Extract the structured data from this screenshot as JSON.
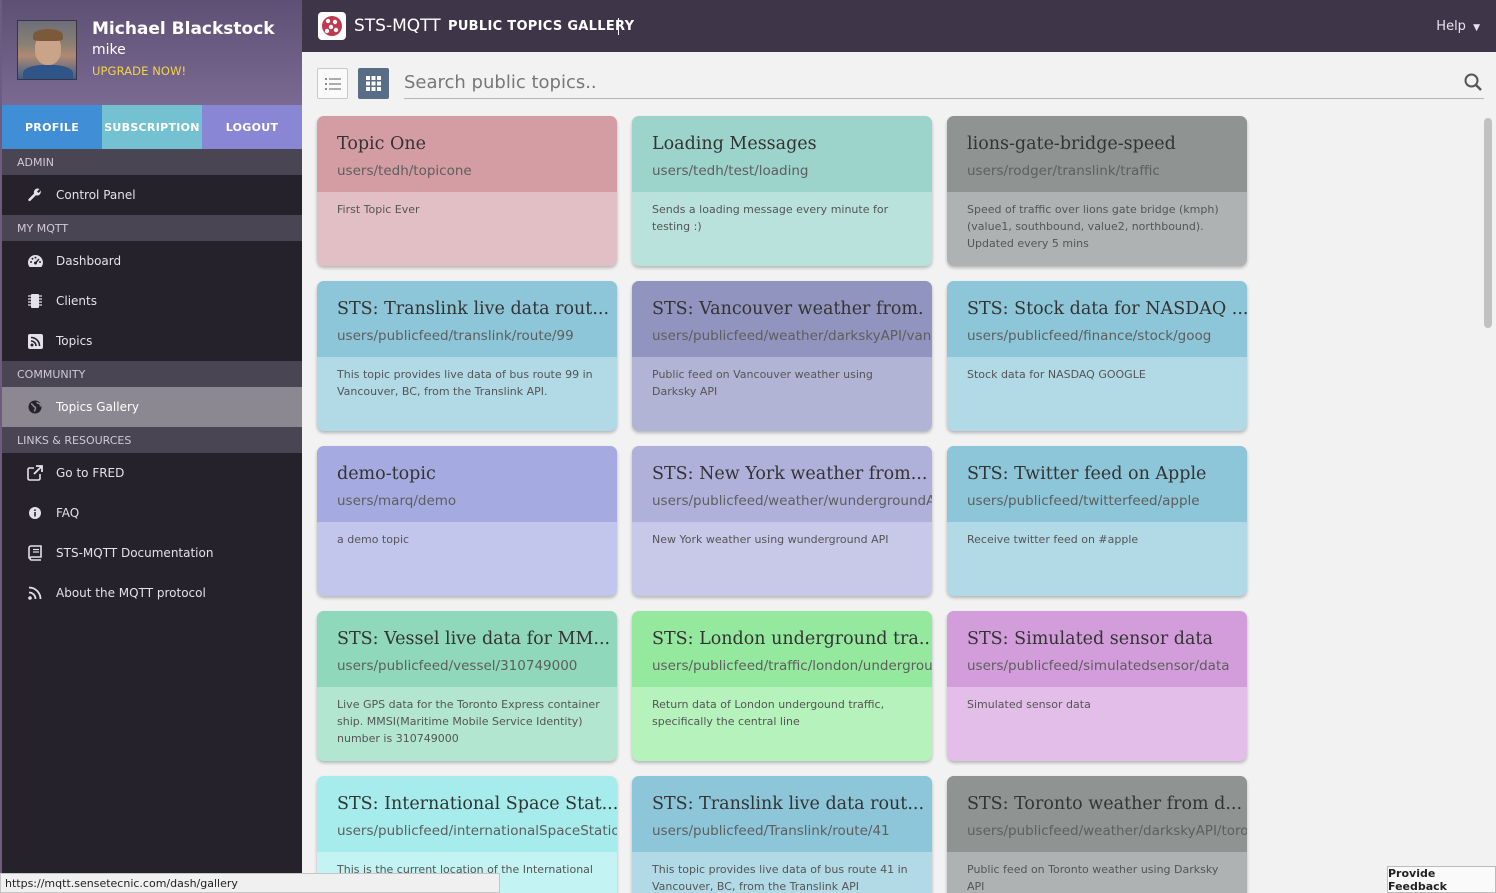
{
  "user": {
    "name": "Michael Blackstock",
    "login": "mike",
    "upgrade_label": "UPGRADE NOW!",
    "buttons": [
      "PROFILE",
      "SUBSCRIPTION",
      "LOGOUT"
    ]
  },
  "sidebar": {
    "sections": [
      {
        "title": "ADMIN",
        "items": [
          {
            "label": "Control Panel",
            "icon": "wrench-icon"
          }
        ]
      },
      {
        "title": "MY MQTT",
        "items": [
          {
            "label": "Dashboard",
            "icon": "dashboard-icon"
          },
          {
            "label": "Clients",
            "icon": "chip-icon"
          },
          {
            "label": "Topics",
            "icon": "rss-square-icon"
          }
        ]
      },
      {
        "title": "COMMUNITY",
        "items": [
          {
            "label": "Topics Gallery",
            "icon": "globe-icon",
            "active": true
          }
        ]
      },
      {
        "title": "LINKS & RESOURCES",
        "items": [
          {
            "label": "Go to FRED",
            "icon": "external-link-icon"
          },
          {
            "label": "FAQ",
            "icon": "info-icon"
          },
          {
            "label": "STS-MQTT Documentation",
            "icon": "book-icon"
          },
          {
            "label": "About the MQTT protocol",
            "icon": "rss-icon"
          }
        ]
      }
    ]
  },
  "topbar": {
    "app_name": "STS-MQTT",
    "page_title": "PUBLIC TOPICS GALLERY",
    "help_label": "Help"
  },
  "search": {
    "placeholder": "Search public topics.."
  },
  "colors": {
    "sidebar_bg": "#25222b",
    "topbar_bg": "#3e3549",
    "profile": "#3f8ed6",
    "subscription": "#74c2d1",
    "logout": "#8a86d6",
    "upgrade": "#f3d447"
  },
  "cards": [
    {
      "title": "Topic One",
      "path": "users/tedh/topicone",
      "desc": "First Topic Ever",
      "head": "#d49da3",
      "body": "#e2bfc4"
    },
    {
      "title": "Loading Messages",
      "path": "users/tedh/test/loading",
      "desc": "Sends a loading message every minute for testing :)",
      "head": "#9cd3cb",
      "body": "#b9e2dd"
    },
    {
      "title": "lions-gate-bridge-speed",
      "path": "users/rodger/translink/traffic",
      "desc": "Speed of traffic over lions gate bridge (kmph) (value1, southbound, value2, northbound). Updated every 5 mins",
      "head": "#8f9493",
      "body": "#aeb2b2"
    },
    {
      "title": "STS: Translink live data rout...",
      "path": "users/publicfeed/translink/route/99",
      "desc": "This topic provides live data of bus route 99 in Vancouver, BC, from the Translink API.",
      "head": "#8dc6d9",
      "body": "#b1d9e6"
    },
    {
      "title": "STS: Vancouver weather from.",
      "path": "users/publicfeed/weather/darkskyAPI/vancouver",
      "desc": "Public feed on Vancouver weather using Darksky API",
      "head": "#9094bf",
      "body": "#b2b4d6"
    },
    {
      "title": "STS: Stock data for NASDAQ ...",
      "path": "users/publicfeed/finance/stock/goog",
      "desc": "Stock data for NASDAQ GOOGLE",
      "head": "#8dc6d9",
      "body": "#b1d9e6"
    },
    {
      "title": "demo-topic",
      "path": "users/marq/demo",
      "desc": "a demo topic",
      "head": "#a5abe0",
      "body": "#c2c6ec"
    },
    {
      "title": "STS: New York weather from...",
      "path": "users/publicfeed/weather/wundergroundAPI/newyork",
      "desc": "New York weather using wunderground API",
      "head": "#afb1db",
      "body": "#c8c9e8"
    },
    {
      "title": "STS: Twitter feed on Apple",
      "path": "users/publicfeed/twitterfeed/apple",
      "desc": "Receive twitter feed on #apple",
      "head": "#8dc6d9",
      "body": "#b1d9e6"
    },
    {
      "title": "STS: Vessel live data for MM...",
      "path": "users/publicfeed/vessel/310749000",
      "desc": "Live GPS data for the Toronto Express container ship. MMSI(Maritime Mobile Service Identity) number is 310749000",
      "head": "#8fd8bb",
      "body": "#b2e6d1"
    },
    {
      "title": "STS: London underground tra..",
      "path": "users/publicfeed/traffic/london/underground",
      "desc": "Return data of London undergound traffic, specifically the central line",
      "head": "#95e99f",
      "body": "#b6f2bc"
    },
    {
      "title": "STS: Simulated sensor data",
      "path": "users/publicfeed/simulatedsensor/data",
      "desc": "Simulated sensor data",
      "head": "#d39ddb",
      "body": "#e2bee8"
    },
    {
      "title": "STS: International Space Stat...",
      "path": "users/publicfeed/internationalSpaceStation/location",
      "desc": "This is the current location of the International",
      "head": "#a6ecec",
      "body": "#c3f3f3"
    },
    {
      "title": "STS: Translink live data rout...",
      "path": "users/publicfeed/Translink/route/41",
      "desc": "This topic provides live data of bus route 41 in Vancouver, BC, from the Translink API",
      "head": "#8dc6d9",
      "body": "#b1d9e6"
    },
    {
      "title": "STS: Toronto weather from d...",
      "path": "users/publicfeed/weather/darkskyAPI/toronto",
      "desc": "Public feed on Toronto weather using Darksky API",
      "head": "#8f9493",
      "body": "#aeb2b2"
    }
  ],
  "status_url": "https://mqtt.sensetecnic.com/dash/gallery",
  "feedback_label": "Provide Feedback"
}
